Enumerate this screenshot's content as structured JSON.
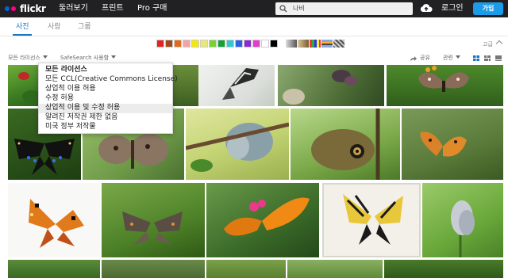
{
  "topnav": {
    "logo": "flickr",
    "links": [
      "둘러보기",
      "프린트",
      "Pro 구매"
    ],
    "search_value": "나비",
    "login": "로그인",
    "join": "가입"
  },
  "subnav": {
    "tabs": [
      "사진",
      "사람",
      "그룹"
    ],
    "active": "사진"
  },
  "color_filters": [
    "#e52222",
    "#a0481a",
    "#e06a1c",
    "#f2a3a3",
    "#f5e610",
    "#e8e87a",
    "#7bd12f",
    "#13a238",
    "#32c7d3",
    "#2b5ee0",
    "#8a2ad1",
    "#e23ec6",
    "#ffffff",
    "#000000"
  ],
  "size_label": "고급",
  "filters": {
    "license": "모든 라이선스",
    "safesearch": "SafeSearch 사용함",
    "share": "공유",
    "sort": "관련"
  },
  "license_dropdown": {
    "items": [
      "모든 라이선스",
      "모든 CCL(Creative Commons License)",
      "상업적 이용 허용",
      "수정 허용",
      "상업적 이용 및 수정 허용",
      "알려진 저작권 제한 없음",
      "미국 정부 저작물"
    ],
    "selected": "모든 라이선스",
    "hover": "상업적 이용 및 수정 허용"
  }
}
